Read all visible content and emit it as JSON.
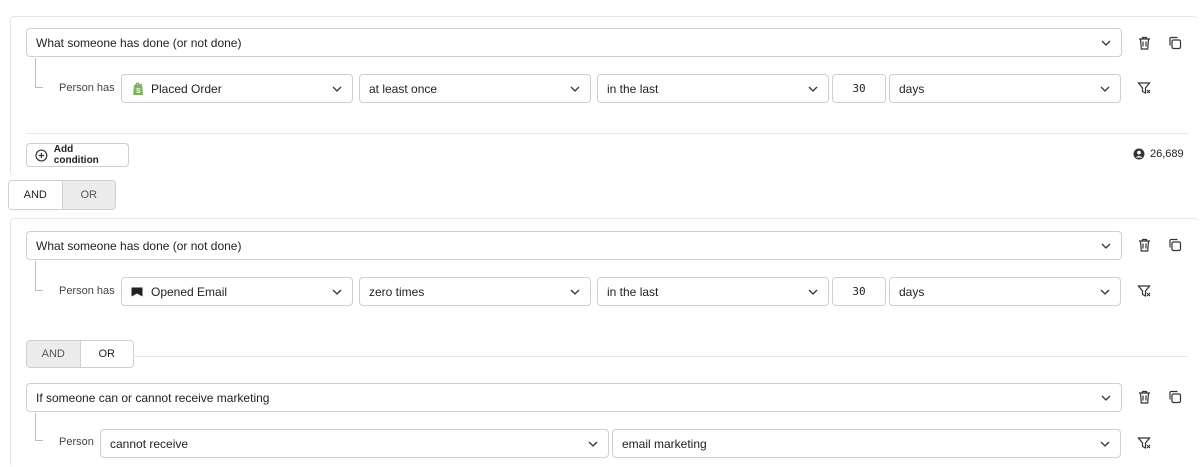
{
  "block1": {
    "type_select": "What someone has done (or not done)",
    "person_label": "Person has",
    "metric_select": "Placed Order",
    "freq_select": "at least once",
    "time_select": "in the last",
    "number": "30",
    "unit_select": "days",
    "add_condition_label": "Add condition",
    "count": "26,689"
  },
  "group_toggle_1": {
    "and": "AND",
    "or": "OR",
    "active": "AND"
  },
  "block2": {
    "type_select": "What someone has done (or not done)",
    "person_label": "Person has",
    "metric_select": "Opened Email",
    "freq_select": "zero times",
    "time_select": "in the last",
    "number": "30",
    "unit_select": "days"
  },
  "group_toggle_2": {
    "and": "AND",
    "or": "OR",
    "active": "OR"
  },
  "block3": {
    "type_select": "If someone can or cannot receive marketing",
    "person_label": "Person",
    "consent_select": "cannot receive",
    "channel_select": "email marketing"
  },
  "colors": {
    "border": "#cfcfcf",
    "inactive_toggle": "#ececec",
    "text": "#1f1f1f"
  },
  "icons": {
    "chevron": "chevron-down-icon",
    "trash": "trash-icon",
    "copy": "copy-icon",
    "filter": "filter-icon",
    "plus": "plus-circle-icon",
    "person": "person-icon",
    "shopify": "shopify-icon",
    "email": "email-flag-icon"
  }
}
